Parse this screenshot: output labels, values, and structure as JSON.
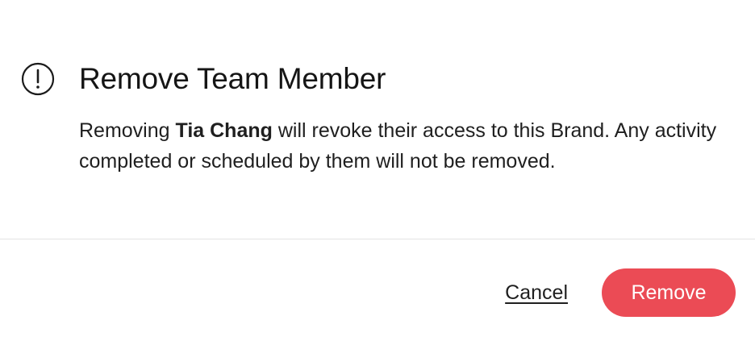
{
  "dialog": {
    "title": "Remove Team Member",
    "message_prefix": "Removing ",
    "member_name": "Tia Chang",
    "message_suffix": " will revoke their access to this Brand. Any activity completed or scheduled by them will not be removed.",
    "icon": "exclamation-circle-icon"
  },
  "footer": {
    "cancel_label": "Cancel",
    "remove_label": "Remove"
  },
  "colors": {
    "danger": "#eb4b55",
    "text": "#1b1b1b",
    "divider": "#e3e3e3"
  }
}
